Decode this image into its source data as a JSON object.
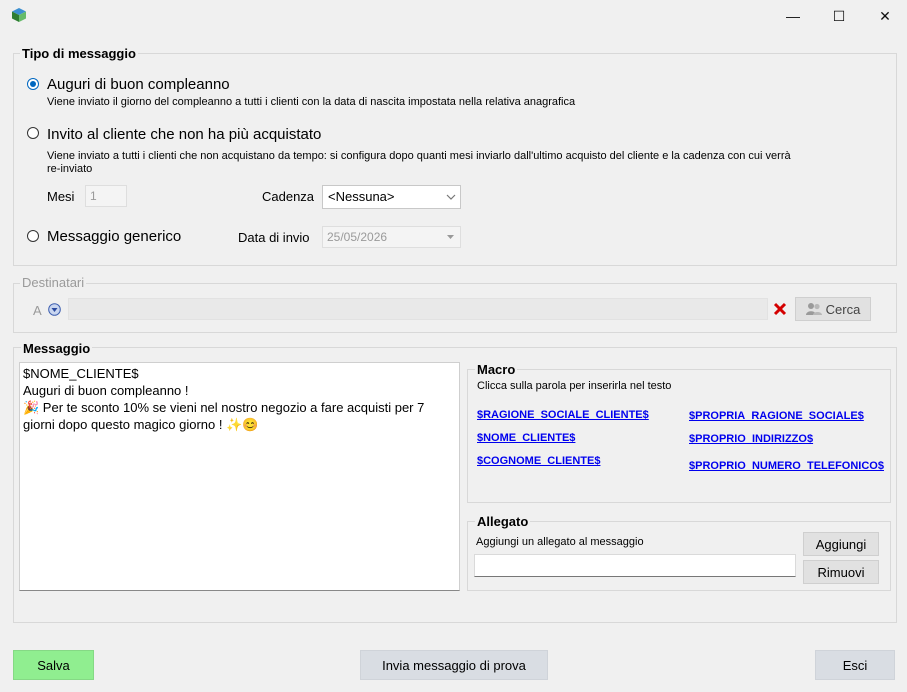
{
  "window": {
    "minimize": "—",
    "maximize": "☐",
    "close": "✕"
  },
  "tipo": {
    "legend": "Tipo di messaggio",
    "auguri": {
      "label": "Auguri di buon compleanno",
      "desc": "Viene inviato il giorno del compleanno a tutti i clienti con la data di nascita impostata nella relativa anagrafica"
    },
    "invito": {
      "label": "Invito al cliente che non ha più acquistato",
      "desc1": "Viene inviato a tutti i clienti che non acquistano da tempo: si configura dopo quanti mesi inviarlo dall'ultimo acquisto del cliente e la cadenza con cui verrà",
      "desc2": "re-inviato"
    },
    "mesi_label": "Mesi",
    "mesi_value": "1",
    "cadenza_label": "Cadenza",
    "cadenza_value": "<Nessuna>",
    "generico_label": "Messaggio generico",
    "data_label": "Data di invio",
    "data_value": "25/05/2026"
  },
  "destinatari": {
    "legend": "Destinatari",
    "a_label": "A",
    "cerca": "Cerca"
  },
  "messaggio": {
    "legend": "Messaggio",
    "lines": [
      "$NOME_CLIENTE$",
      "Auguri di buon compleanno !",
      "🎉 Per te sconto 10% se vieni nel nostro negozio a fare acquisti per 7",
      "giorni dopo questo magico giorno ! ✨😊"
    ]
  },
  "macro": {
    "legend": "Macro",
    "hint": "Clicca sulla parola per inserirla nel testo",
    "items": [
      "$RAGIONE_SOCIALE_CLIENTE$",
      "$NOME_CLIENTE$",
      "$COGNOME_CLIENTE$",
      "$PROPRIA_RAGIONE_SOCIALE$",
      "$PROPRIO_INDIRIZZO$",
      "$PROPRIO_NUMERO_TELEFONICO$"
    ]
  },
  "allegato": {
    "legend": "Allegato",
    "hint": "Aggiungi un allegato al messaggio",
    "aggiungi": "Aggiungi",
    "rimuovi": "Rimuovi"
  },
  "footer": {
    "salva": "Salva",
    "prova": "Invia messaggio di prova",
    "esci": "Esci"
  },
  "colors": {
    "salva_bg": "#90ee90",
    "link": "#0000ee",
    "accent": "#0067c0",
    "delete": "#d40000"
  }
}
